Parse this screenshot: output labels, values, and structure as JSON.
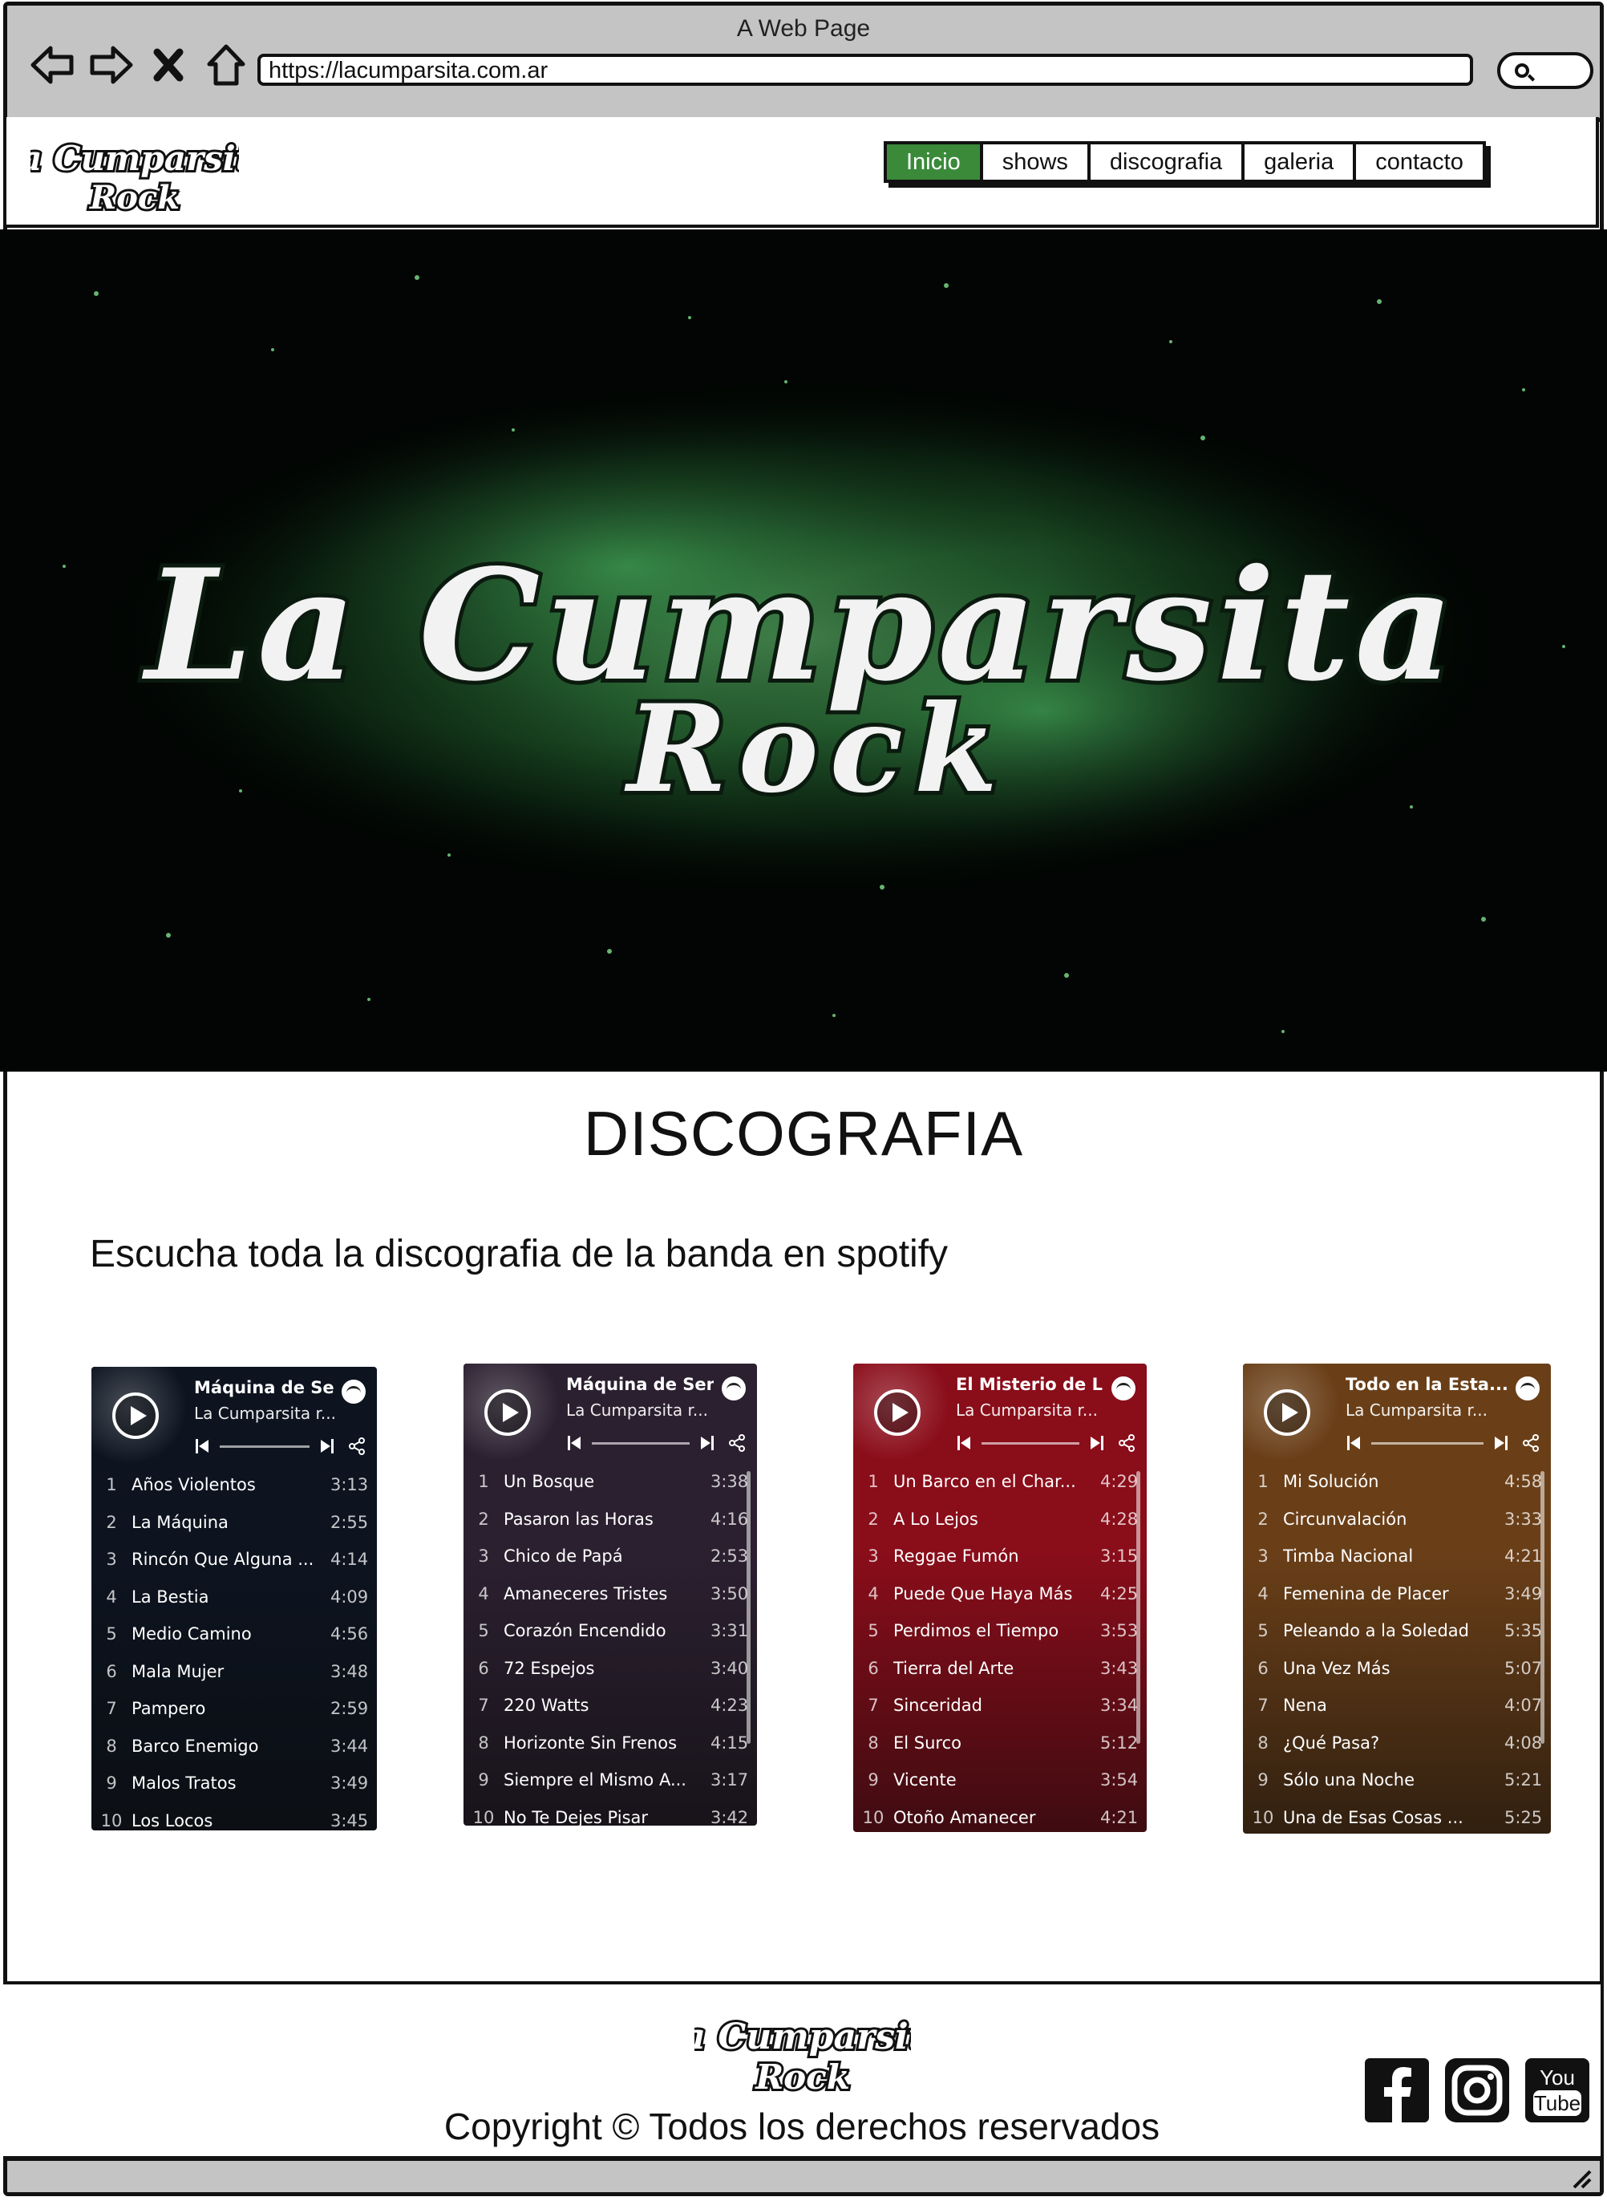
{
  "browser": {
    "window_title": "A Web Page",
    "url": "https://lacumparsita.com.ar"
  },
  "site": {
    "logo_text_top": "La Cumparsita",
    "logo_text_bottom": "Rock",
    "nav": [
      {
        "label": "Inicio",
        "active": true
      },
      {
        "label": "shows",
        "active": false
      },
      {
        "label": "discografia",
        "active": false
      },
      {
        "label": "galeria",
        "active": false
      },
      {
        "label": "contacto",
        "active": false
      }
    ]
  },
  "hero": {
    "logo_text_top": "La Cumparsita",
    "logo_text_bottom": "Rock",
    "accent": "#3f9a4f"
  },
  "discografia": {
    "title": "DISCOGRAFIA",
    "subtitle": "Escucha toda la discografia de la banda en spotify"
  },
  "players": [
    {
      "title": "Máquina de Sen...",
      "artist": "La Cumparsita r...",
      "bg": "#0d1420",
      "tracks": [
        {
          "n": "1",
          "name": "Años Violentos",
          "dur": "3:13"
        },
        {
          "n": "2",
          "name": "La Máquina",
          "dur": "2:55"
        },
        {
          "n": "3",
          "name": "Rincón Que Alguna ...",
          "dur": "4:14"
        },
        {
          "n": "4",
          "name": "La Bestia",
          "dur": "4:09"
        },
        {
          "n": "5",
          "name": "Medio Camino",
          "dur": "4:56"
        },
        {
          "n": "6",
          "name": "Mala Mujer",
          "dur": "3:48"
        },
        {
          "n": "7",
          "name": "Pampero",
          "dur": "2:59"
        },
        {
          "n": "8",
          "name": "Barco Enemigo",
          "dur": "3:44"
        },
        {
          "n": "9",
          "name": "Malos Tratos",
          "dur": "3:49"
        },
        {
          "n": "10",
          "name": "Los Locos",
          "dur": "3:45"
        }
      ]
    },
    {
      "title": "Máquina de Sen...",
      "artist": "La Cumparsita r...",
      "bg": "#2b2030",
      "tracks": [
        {
          "n": "1",
          "name": "Un Bosque",
          "dur": "3:38"
        },
        {
          "n": "2",
          "name": "Pasaron las Horas",
          "dur": "4:16"
        },
        {
          "n": "3",
          "name": "Chico de Papá",
          "dur": "2:53"
        },
        {
          "n": "4",
          "name": "Amaneceres Tristes",
          "dur": "3:50"
        },
        {
          "n": "5",
          "name": "Corazón Encendido",
          "dur": "3:31"
        },
        {
          "n": "6",
          "name": "72 Espejos",
          "dur": "3:40"
        },
        {
          "n": "7",
          "name": "220 Watts",
          "dur": "4:23"
        },
        {
          "n": "8",
          "name": "Horizonte Sin Frenos",
          "dur": "4:15"
        },
        {
          "n": "9",
          "name": "Siempre el Mismo A...",
          "dur": "3:17"
        },
        {
          "n": "10",
          "name": "No Te Dejes Pisar",
          "dur": "3:42"
        }
      ]
    },
    {
      "title": "El Misterio de L...",
      "artist": "La Cumparsita r...",
      "bg": "#8a0d1a",
      "tracks": [
        {
          "n": "1",
          "name": "Un Barco en el Char...",
          "dur": "4:29"
        },
        {
          "n": "2",
          "name": "A Lo Lejos",
          "dur": "4:28"
        },
        {
          "n": "3",
          "name": "Reggae Fumón",
          "dur": "3:15"
        },
        {
          "n": "4",
          "name": "Puede Que Haya Más",
          "dur": "4:25"
        },
        {
          "n": "5",
          "name": "Perdimos el Tiempo",
          "dur": "3:53"
        },
        {
          "n": "6",
          "name": "Tierra del Arte",
          "dur": "3:43"
        },
        {
          "n": "7",
          "name": "Sinceridad",
          "dur": "3:34"
        },
        {
          "n": "8",
          "name": "El Surco",
          "dur": "5:12"
        },
        {
          "n": "9",
          "name": "Vicente",
          "dur": "3:54"
        },
        {
          "n": "10",
          "name": "Otoño Amanecer",
          "dur": "4:21"
        }
      ]
    },
    {
      "title": "Todo en la Esta...",
      "artist": "La Cumparsita r...",
      "bg": "#6a3f18",
      "tracks": [
        {
          "n": "1",
          "name": "Mi Solución",
          "dur": "4:58"
        },
        {
          "n": "2",
          "name": "Circunvalación",
          "dur": "3:33"
        },
        {
          "n": "3",
          "name": "Timba Nacional",
          "dur": "4:21"
        },
        {
          "n": "4",
          "name": "Femenina de Placer",
          "dur": "3:49"
        },
        {
          "n": "5",
          "name": "Peleando a la Soledad",
          "dur": "5:35"
        },
        {
          "n": "6",
          "name": "Una Vez Más",
          "dur": "5:07"
        },
        {
          "n": "7",
          "name": "Nena",
          "dur": "4:07"
        },
        {
          "n": "8",
          "name": "¿Qué Pasa?",
          "dur": "4:08"
        },
        {
          "n": "9",
          "name": "Sólo una Noche",
          "dur": "5:21"
        },
        {
          "n": "10",
          "name": "Una de Esas Cosas ...",
          "dur": "5:25"
        }
      ]
    }
  ],
  "footer": {
    "logo_text_top": "La Cumparsita",
    "logo_text_bottom": "Rock",
    "copyright": "Copyright © Todos los derechos reservados",
    "socials": [
      {
        "icon": "facebook-icon"
      },
      {
        "icon": "instagram-icon"
      },
      {
        "icon": "youtube-icon",
        "text_top": "You",
        "text_bottom": "Tube"
      }
    ]
  }
}
